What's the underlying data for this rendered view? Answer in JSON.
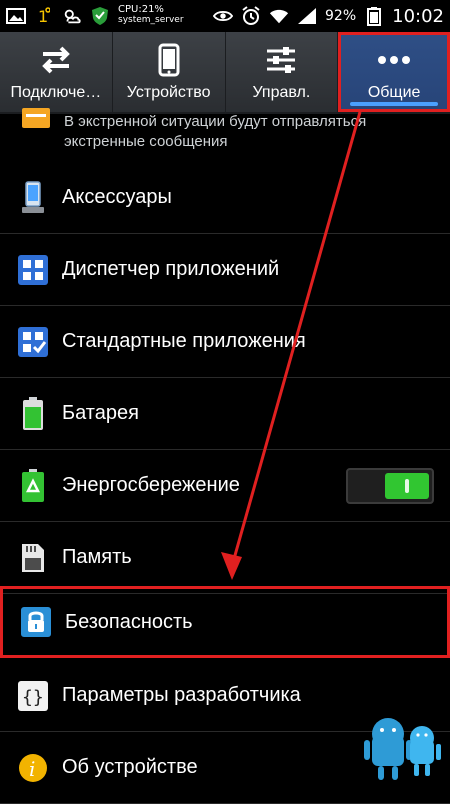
{
  "status_bar": {
    "cpu": "CPU:21%",
    "process": "system_server",
    "battery": "92%",
    "time": "10:02"
  },
  "tabs": [
    {
      "label": "Подключе…",
      "icon": "swap-arrows-icon"
    },
    {
      "label": "Устройство",
      "icon": "phone-icon"
    },
    {
      "label": "Управл.",
      "icon": "sliders-icon"
    },
    {
      "label": "Общие",
      "icon": "more-dots-icon",
      "active": true
    }
  ],
  "partial_text_lines": [
    "В экстренной ситуации будут отправляться",
    "экстренные сообщения"
  ],
  "items": [
    {
      "label": "Аксессуары",
      "icon": "accessory-phone-icon"
    },
    {
      "label": "Диспетчер приложений",
      "icon": "app-grid-icon"
    },
    {
      "label": "Стандартные приложения",
      "icon": "default-apps-icon"
    },
    {
      "label": "Батарея",
      "icon": "battery-icon"
    },
    {
      "label": "Энергосбережение",
      "icon": "recycle-battery-icon",
      "toggle": {
        "on": true
      }
    },
    {
      "label": "Память",
      "icon": "sd-card-icon"
    },
    {
      "label": "Безопасность",
      "icon": "lock-icon",
      "highlight": true
    },
    {
      "label": "Параметры разработчика",
      "icon": "curly-braces-icon"
    },
    {
      "label": "Об устройстве",
      "icon": "info-icon"
    }
  ],
  "colors": {
    "highlight_red": "#e02020",
    "active_tab_blue": "#2f4f86",
    "toggle_green": "#31c631"
  }
}
